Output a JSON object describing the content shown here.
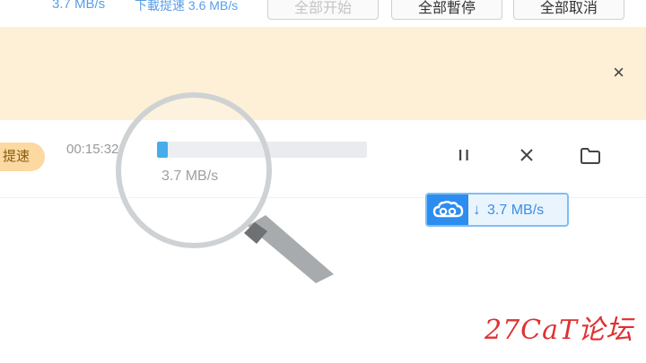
{
  "toolbar": {
    "total_speed": "3.7 MB/s",
    "download_speed": "下載提速 3.6 MB/s",
    "start_all_label": "全部开始",
    "pause_all_label": "全部暫停",
    "cancel_all_label": "全部取消"
  },
  "banner": {
    "close_glyph": "×"
  },
  "download_row": {
    "badge_label": "提速",
    "time_remaining": "00:15:32",
    "progress": 0.05,
    "speed": "3.7 MB/s"
  },
  "accel_widget": {
    "arrow": "↓",
    "speed": "3.7 MB/s"
  },
  "watermark": {
    "text": "27CaT论坛"
  },
  "colors": {
    "accent": "#2d8cf0",
    "banner_bg": "#fdf0d6",
    "badge_bg": "#fbd9a0",
    "watermark": "#e03030"
  },
  "icons": [
    "pause-icon",
    "close-icon",
    "folder-icon",
    "cloud-accelerate-icon",
    "magnifier-icon"
  ]
}
